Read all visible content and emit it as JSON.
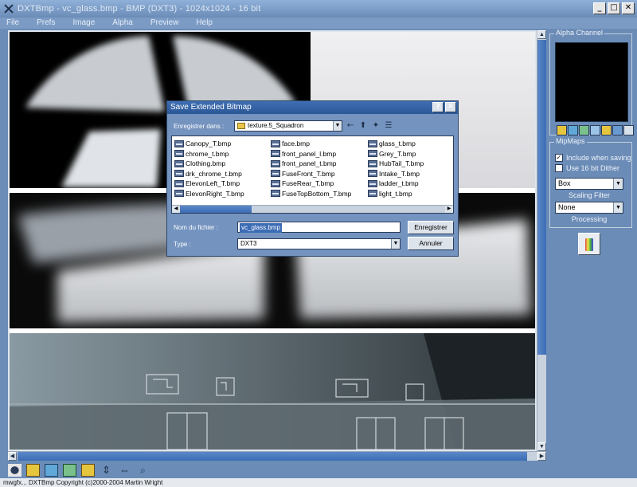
{
  "window": {
    "title": "DXTBmp - vc_glass.bmp - BMP (DXT3) - 1024x1024 - 16 bit",
    "min": "_",
    "max": "□",
    "close": "✕"
  },
  "menu": [
    "File",
    "Prefs",
    "Image",
    "Alpha",
    "Preview",
    "Help"
  ],
  "panel": {
    "alpha_title": "Alpha Channel",
    "mipmaps_title": "MipMaps",
    "include_when_saving": "Include when saving",
    "include_checked": "✓",
    "use_16bit": "Use 16 bit Dither",
    "filter_value": "Box",
    "scaling_filter_label": "Scaling Filter",
    "processing_value": "None",
    "processing_label": "Processing"
  },
  "dialog": {
    "title": "Save Extended Bitmap",
    "help": "?",
    "close": "✕",
    "look_in_label": "Enregistrer dans :",
    "look_in_value": "texture.5_Squadron",
    "files_col1": [
      "Canopy_T.bmp",
      "chrome_t.bmp",
      "Clothing.bmp",
      "drk_chrome_t.bmp",
      "ElevonLeft_T.bmp",
      "ElevonRight_T.bmp"
    ],
    "files_col2": [
      "face.bmp",
      "front_panel_l.bmp",
      "front_panel_t.bmp",
      "FuseFront_T.bmp",
      "FuseRear_T.bmp",
      "FuseTopBottom_T.bmp"
    ],
    "files_col3": [
      "glass_t.bmp",
      "Grey_T.bmp",
      "HubTail_T.bmp",
      "Intake_T.bmp",
      "ladder_t.bmp",
      "light_t.bmp"
    ],
    "filename_label": "Nom du fichier :",
    "filename_value": "vc_glass.bmp",
    "type_label": "Type :",
    "type_value": "DXT3",
    "save_button": "Enregistrer",
    "cancel_button": "Annuler"
  },
  "status": "mwgfx... DXTBmp Copyright (c)2000-2004 Martin Wright",
  "colors": {
    "window_bg": "#6b8cb7",
    "title_bar": "#2b5796",
    "accent": "#3c6cb4"
  }
}
